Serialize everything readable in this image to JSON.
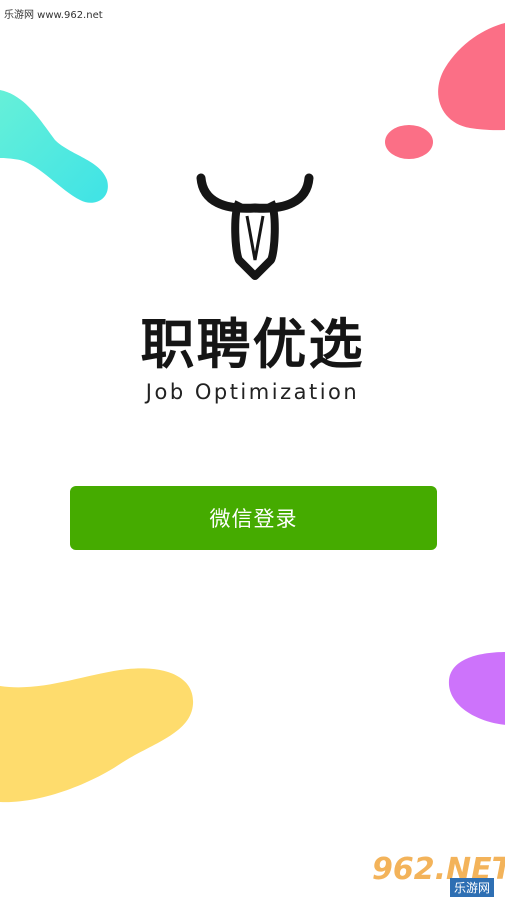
{
  "watermark_top": "乐游网 www.962.net",
  "app": {
    "name_cn": "职聘优选",
    "name_en": "Job Optimization"
  },
  "login": {
    "wechat_label": "微信登录"
  },
  "watermark_bottom": {
    "main": "962.NET",
    "sub": "乐游网"
  },
  "colors": {
    "button": "#45ab00",
    "blob_teal": "#5ee9dc",
    "blob_pink": "#fb6f86",
    "blob_yellow": "#fedc6d",
    "blob_purple": "#cd73fb"
  }
}
